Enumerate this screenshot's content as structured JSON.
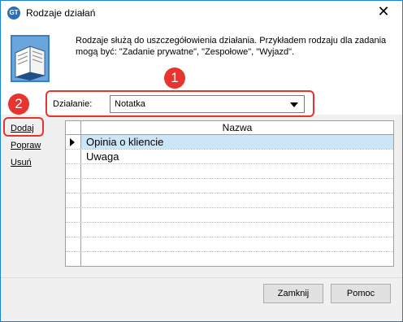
{
  "window": {
    "title": "Rodzaje działań",
    "close_glyph": "✕",
    "app_icon_text": "GT"
  },
  "description": "Rodzaje służą do uszczegółowienia działania. Przykładem rodzaju dla zadania mogą być: \"Zadanie prywatne\", \"Zespołowe\", \"Wyjazd\".",
  "annotations": {
    "badge1": "1",
    "badge2": "2",
    "highlight_color": "#e8342f"
  },
  "filter": {
    "label": "Działanie:",
    "selected": "Notatka"
  },
  "side_links": {
    "add": "Dodaj",
    "edit": "Popraw",
    "delete": "Usuń"
  },
  "grid": {
    "header": "Nazwa",
    "rows": [
      "Opinia o kliencie",
      "Uwaga"
    ],
    "selected_row": 0
  },
  "buttons": {
    "close": "Zamknij",
    "help": "Pomoc"
  }
}
